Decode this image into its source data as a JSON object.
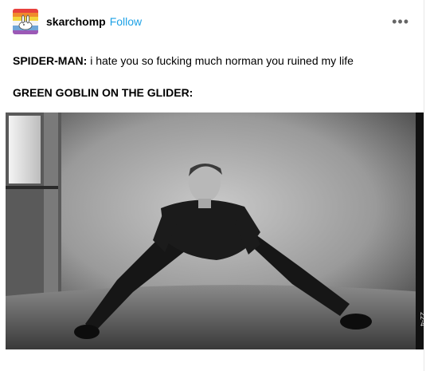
{
  "post": {
    "author": {
      "username": "skarchomp",
      "follow_label": "Follow",
      "avatar_icon": "avatar-bunny-rainbow-icon"
    },
    "more_icon": "more-options-icon",
    "lines": [
      {
        "speaker": "SPIDER-MAN:",
        "text": " i hate you so fucking much norman you ruined my life"
      },
      {
        "speaker": "GREEN GOBLIN ON THE GLIDER:",
        "text": ""
      }
    ],
    "image": {
      "description": "black-and-white photo of a man in dark clothing doing a wide-legged squat in a studio",
      "film_mark": "22-4"
    }
  },
  "colors": {
    "follow": "#1ea2e6",
    "text": "#000000"
  }
}
